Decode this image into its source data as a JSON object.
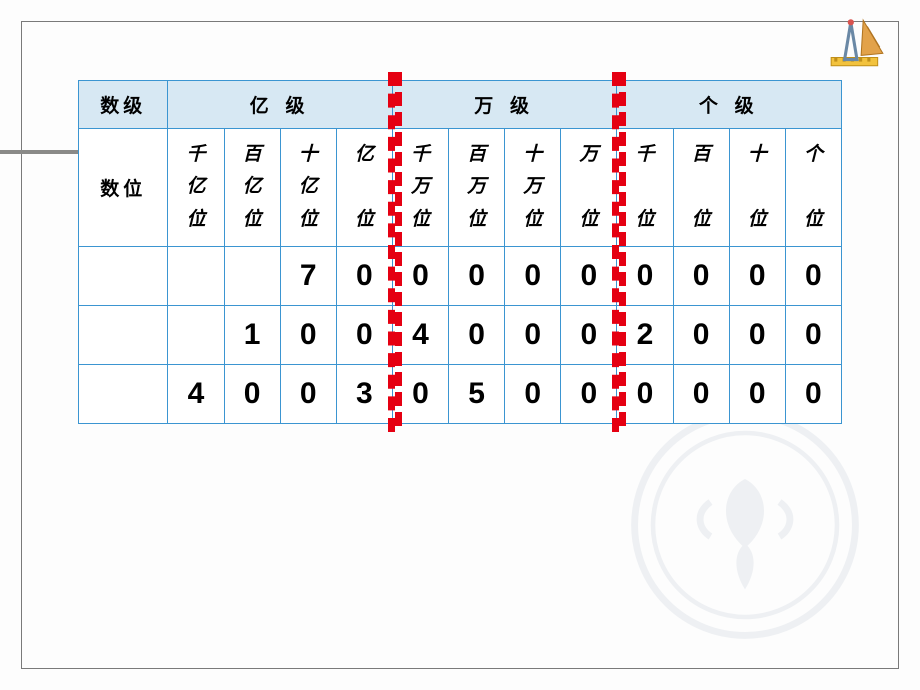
{
  "headers": {
    "level_label": "数级",
    "place_label": "数位",
    "levels": [
      "亿 级",
      "万 级",
      "个 级"
    ]
  },
  "places": [
    "千亿位",
    "百亿位",
    "十亿位",
    "亿位",
    "千万位",
    "百万位",
    "十万位",
    "万位",
    "千位",
    "百位",
    "十位",
    "个位"
  ],
  "rows": [
    [
      "",
      "",
      "7",
      "0",
      "0",
      "0",
      "0",
      "0",
      "0",
      "0",
      "0",
      "0"
    ],
    [
      "",
      "1",
      "0",
      "0",
      "4",
      "0",
      "0",
      "0",
      "2",
      "0",
      "0",
      "0"
    ],
    [
      "4",
      "0",
      "0",
      "3",
      "0",
      "5",
      "0",
      "0",
      "0",
      "0",
      "0",
      "0"
    ]
  ],
  "chart_data": {
    "type": "table",
    "description": "Chinese place-value chart (数位表) with three number-levels: 亿级 (hundred-millions), 万级 (ten-thousands), 个级 (units). Three sample numbers entered.",
    "columns": [
      "千亿位",
      "百亿位",
      "十亿位",
      "亿位",
      "千万位",
      "百万位",
      "十万位",
      "万位",
      "千位",
      "百位",
      "十位",
      "个位"
    ],
    "numbers": [
      7000000000,
      10040002000,
      400305000000
    ]
  }
}
